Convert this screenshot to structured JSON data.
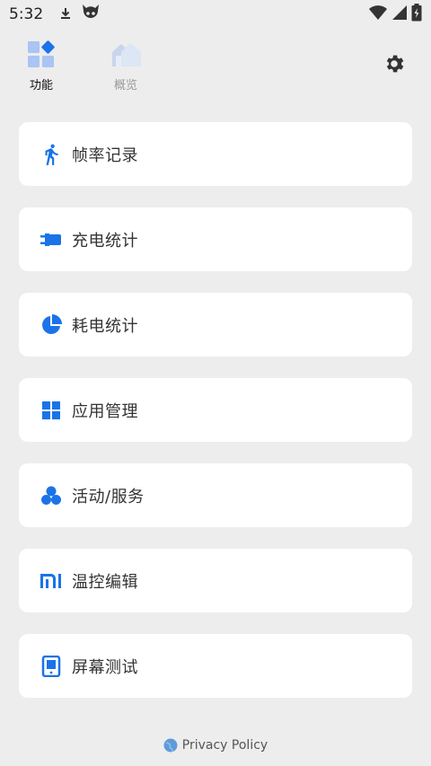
{
  "status_bar": {
    "time": "5:32",
    "icons": [
      "download-icon",
      "devil-face-icon",
      "wifi-icon",
      "signal-icon",
      "battery-charging-icon"
    ]
  },
  "tabs": [
    {
      "label": "功能",
      "icon": "function-grid-icon",
      "active": true
    },
    {
      "label": "概览",
      "icon": "overview-home-icon",
      "active": false
    }
  ],
  "settings": {
    "icon": "gear-icon"
  },
  "menu": {
    "items": [
      {
        "label": "帧率记录",
        "icon": "running-person-icon"
      },
      {
        "label": "充电统计",
        "icon": "charger-plug-icon"
      },
      {
        "label": "耗电统计",
        "icon": "pie-chart-icon"
      },
      {
        "label": "应用管理",
        "icon": "app-grid-icon"
      },
      {
        "label": "活动/服务",
        "icon": "bubbles-icon"
      },
      {
        "label": "温控编辑",
        "icon": "mi-logo-icon"
      },
      {
        "label": "屏幕测试",
        "icon": "tablet-screen-icon"
      }
    ]
  },
  "footer": {
    "privacy_label": "Privacy Policy",
    "icon": "globe-icon"
  },
  "colors": {
    "accent": "#1a73e8",
    "background": "#ededed",
    "card": "#ffffff"
  }
}
